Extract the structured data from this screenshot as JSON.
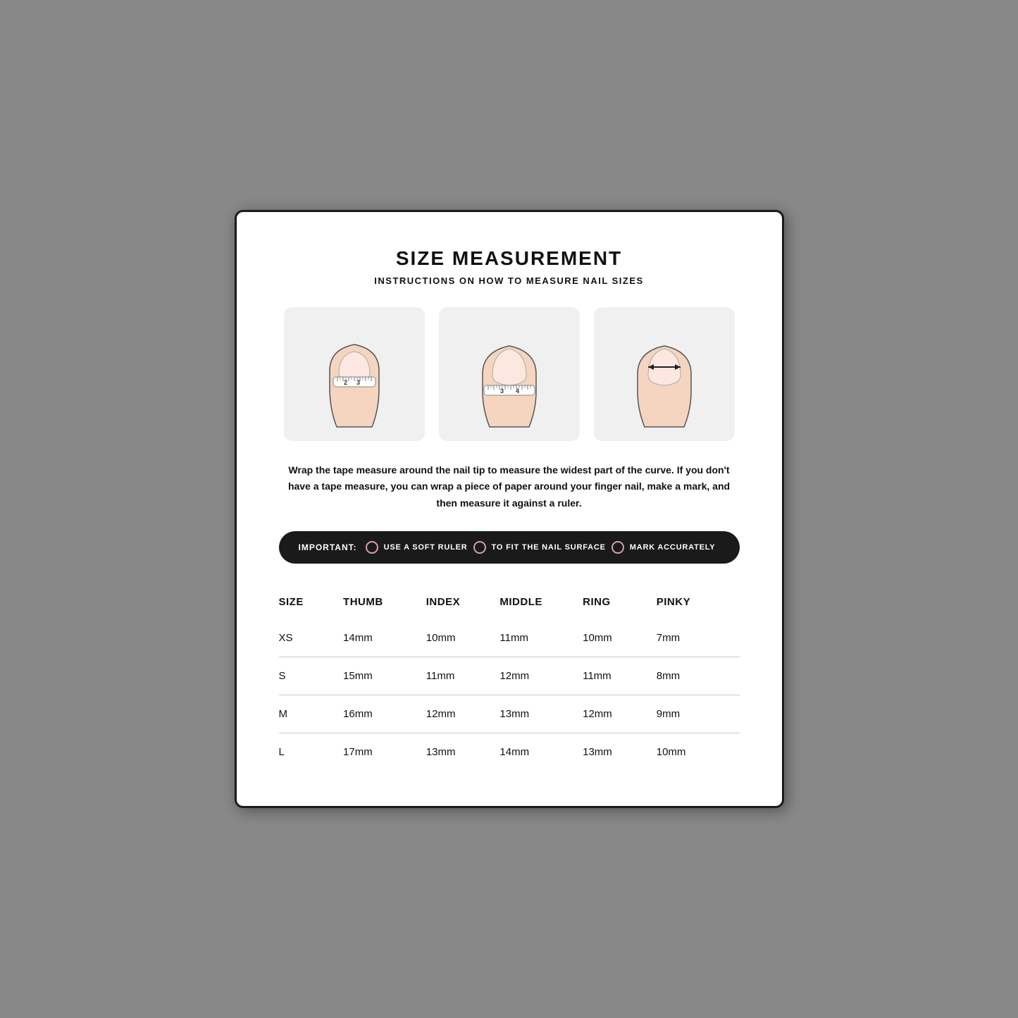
{
  "page": {
    "title": "SIZE MEASUREMENT",
    "subtitle": "INSTRUCTIONS ON HOW TO MEASURE NAIL SIZES",
    "description": "Wrap the tape measure around the nail tip to measure the widest part of the curve. If you don't have a tape measure, you can wrap a piece of paper around your finger nail, make a mark, and then measure it against a ruler.",
    "important_label": "IMPORTANT:",
    "tips": [
      "USE A SOFT RULER",
      "TO FIT THE NAIL SURFACE",
      "MARK ACCURATELY"
    ]
  },
  "table": {
    "headers": [
      "SIZE",
      "THUMB",
      "INDEX",
      "MIDDLE",
      "RING",
      "PINKY"
    ],
    "rows": [
      {
        "size": "XS",
        "thumb": "14mm",
        "index": "10mm",
        "middle": "11mm",
        "ring": "10mm",
        "pinky": "7mm"
      },
      {
        "size": "S",
        "thumb": "15mm",
        "index": "11mm",
        "middle": "12mm",
        "ring": "11mm",
        "pinky": "8mm"
      },
      {
        "size": "M",
        "thumb": "16mm",
        "index": "12mm",
        "middle": "13mm",
        "ring": "12mm",
        "pinky": "9mm"
      },
      {
        "size": "L",
        "thumb": "17mm",
        "index": "13mm",
        "middle": "14mm",
        "ring": "13mm",
        "pinky": "10mm"
      }
    ]
  }
}
